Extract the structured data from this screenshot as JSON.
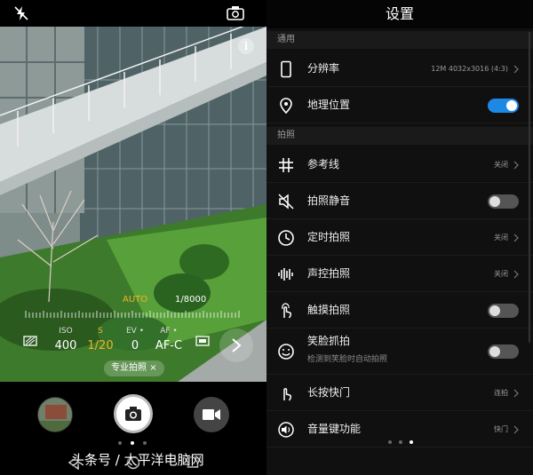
{
  "camera": {
    "pro_mode": {
      "metering_mode": "AUTO",
      "shutter_top": "1/8000",
      "params": [
        {
          "label": "ISO",
          "value": "400",
          "active": false
        },
        {
          "label": "S",
          "value": "1/20",
          "active": true
        },
        {
          "label": "EV •",
          "value": "0",
          "active": false
        },
        {
          "label": "AF •",
          "value": "AF-C",
          "active": false
        }
      ],
      "mode_chip": "专业拍照",
      "mode_chip_close": "×"
    },
    "icons": {
      "flash": "flash-off-icon",
      "switch_camera": "switch-camera-icon",
      "info": "i"
    }
  },
  "settings": {
    "title": "设置",
    "sections": [
      {
        "header": "通用",
        "rows": [
          {
            "icon": "phone-icon",
            "title": "分辨率",
            "value": "12M 4032x3016 (4:3)",
            "control": "chevron"
          },
          {
            "icon": "location-icon",
            "title": "地理位置",
            "control": "toggle",
            "on": true
          }
        ]
      },
      {
        "header": "拍照",
        "rows": [
          {
            "icon": "grid-icon",
            "title": "参考线",
            "value": "关闭",
            "control": "chevron"
          },
          {
            "icon": "mute-icon",
            "title": "拍照静音",
            "control": "toggle",
            "on": false
          },
          {
            "icon": "timer-icon",
            "title": "定时拍照",
            "value": "关闭",
            "control": "chevron"
          },
          {
            "icon": "voice-wave-icon",
            "title": "声控拍照",
            "value": "关闭",
            "control": "chevron"
          },
          {
            "icon": "touch-icon",
            "title": "触摸拍照",
            "control": "toggle",
            "on": false
          },
          {
            "icon": "smile-icon",
            "title": "笑脸抓拍",
            "subtitle": "检测到笑脸时自动拍照",
            "control": "toggle",
            "on": false
          },
          {
            "icon": "long-press-icon",
            "title": "长按快门",
            "value": "连拍",
            "control": "chevron"
          },
          {
            "icon": "volume-key-icon",
            "title": "音量键功能",
            "value": "快门",
            "control": "chevron"
          }
        ]
      }
    ]
  },
  "watermark": "头条号 / 太平洋电脑网",
  "colors": {
    "accent": "#1e88e5",
    "pro_highlight": "#f5b324",
    "settings_bg": "#101010"
  }
}
